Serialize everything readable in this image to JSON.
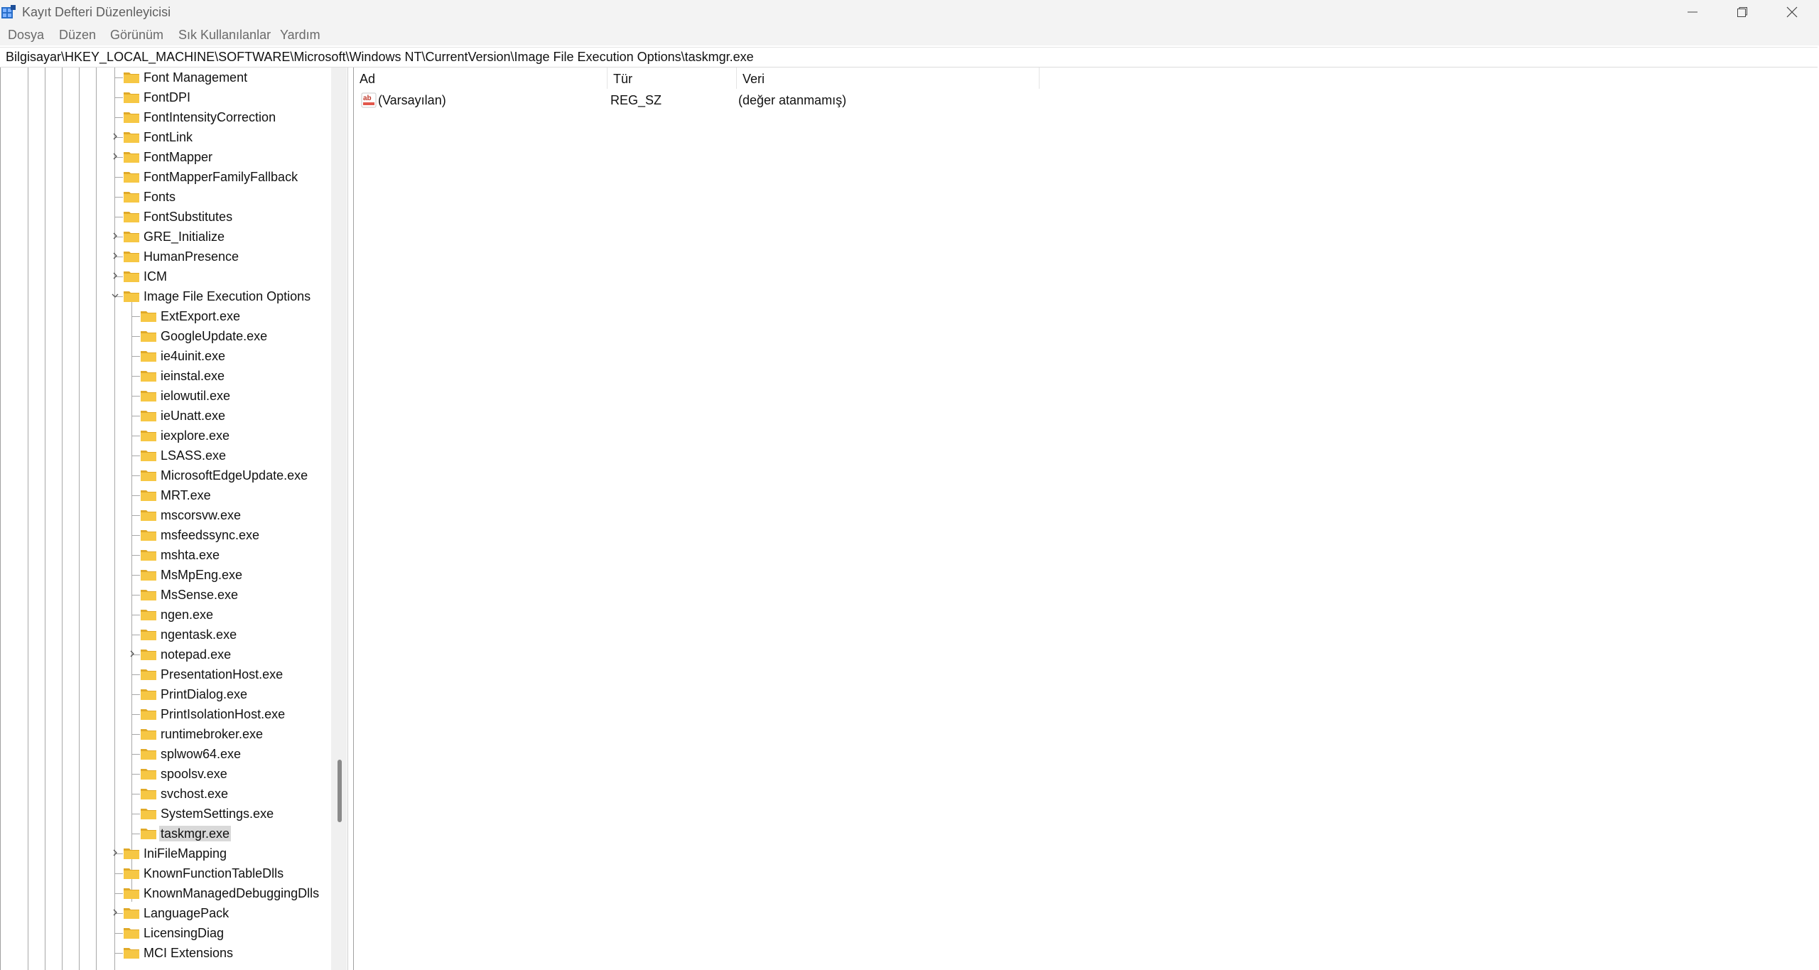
{
  "window": {
    "title": "Kayıt Defteri Düzenleyicisi",
    "controls": [
      "minimize-icon",
      "maximize-icon",
      "close-icon"
    ]
  },
  "menu": {
    "items": [
      "Dosya",
      "Düzen",
      "Görünüm",
      "Sık Kullanılanlar",
      "Yardım"
    ]
  },
  "address": {
    "path": "Bilgisayar\\HKEY_LOCAL_MACHINE\\SOFTWARE\\Microsoft\\Windows NT\\CurrentVersion\\Image File Execution Options\\taskmgr.exe"
  },
  "tree": {
    "items": [
      {
        "label": "Font Management",
        "level": 1,
        "expandable": false
      },
      {
        "label": "FontDPI",
        "level": 1,
        "expandable": false
      },
      {
        "label": "FontIntensityCorrection",
        "level": 1,
        "expandable": false
      },
      {
        "label": "FontLink",
        "level": 1,
        "expandable": true
      },
      {
        "label": "FontMapper",
        "level": 1,
        "expandable": true
      },
      {
        "label": "FontMapperFamilyFallback",
        "level": 1,
        "expandable": false
      },
      {
        "label": "Fonts",
        "level": 1,
        "expandable": false
      },
      {
        "label": "FontSubstitutes",
        "level": 1,
        "expandable": false
      },
      {
        "label": "GRE_Initialize",
        "level": 1,
        "expandable": true
      },
      {
        "label": "HumanPresence",
        "level": 1,
        "expandable": true
      },
      {
        "label": "ICM",
        "level": 1,
        "expandable": true
      },
      {
        "label": "Image File Execution Options",
        "level": 1,
        "expandable": true,
        "expanded": true
      },
      {
        "label": "ExtExport.exe",
        "level": 2,
        "expandable": false
      },
      {
        "label": "GoogleUpdate.exe",
        "level": 2,
        "expandable": false
      },
      {
        "label": "ie4uinit.exe",
        "level": 2,
        "expandable": false
      },
      {
        "label": "ieinstal.exe",
        "level": 2,
        "expandable": false
      },
      {
        "label": "ielowutil.exe",
        "level": 2,
        "expandable": false
      },
      {
        "label": "ieUnatt.exe",
        "level": 2,
        "expandable": false
      },
      {
        "label": "iexplore.exe",
        "level": 2,
        "expandable": false
      },
      {
        "label": "LSASS.exe",
        "level": 2,
        "expandable": false
      },
      {
        "label": "MicrosoftEdgeUpdate.exe",
        "level": 2,
        "expandable": false
      },
      {
        "label": "MRT.exe",
        "level": 2,
        "expandable": false
      },
      {
        "label": "mscorsvw.exe",
        "level": 2,
        "expandable": false
      },
      {
        "label": "msfeedssync.exe",
        "level": 2,
        "expandable": false
      },
      {
        "label": "mshta.exe",
        "level": 2,
        "expandable": false
      },
      {
        "label": "MsMpEng.exe",
        "level": 2,
        "expandable": false
      },
      {
        "label": "MsSense.exe",
        "level": 2,
        "expandable": false
      },
      {
        "label": "ngen.exe",
        "level": 2,
        "expandable": false
      },
      {
        "label": "ngentask.exe",
        "level": 2,
        "expandable": false
      },
      {
        "label": "notepad.exe",
        "level": 2,
        "expandable": true
      },
      {
        "label": "PresentationHost.exe",
        "level": 2,
        "expandable": false
      },
      {
        "label": "PrintDialog.exe",
        "level": 2,
        "expandable": false
      },
      {
        "label": "PrintIsolationHost.exe",
        "level": 2,
        "expandable": false
      },
      {
        "label": "runtimebroker.exe",
        "level": 2,
        "expandable": false
      },
      {
        "label": "splwow64.exe",
        "level": 2,
        "expandable": false
      },
      {
        "label": "spoolsv.exe",
        "level": 2,
        "expandable": false
      },
      {
        "label": "svchost.exe",
        "level": 2,
        "expandable": false
      },
      {
        "label": "SystemSettings.exe",
        "level": 2,
        "expandable": false
      },
      {
        "label": "taskmgr.exe",
        "level": 2,
        "expandable": false,
        "selected": true
      },
      {
        "label": "IniFileMapping",
        "level": 1,
        "expandable": true
      },
      {
        "label": "KnownFunctionTableDlls",
        "level": 1,
        "expandable": false
      },
      {
        "label": "KnownManagedDebuggingDlls",
        "level": 1,
        "expandable": false
      },
      {
        "label": "LanguagePack",
        "level": 1,
        "expandable": true
      },
      {
        "label": "LicensingDiag",
        "level": 1,
        "expandable": false
      },
      {
        "label": "MCI Extensions",
        "level": 1,
        "expandable": false
      }
    ]
  },
  "values": {
    "columns": [
      "Ad",
      "Tür",
      "Veri"
    ],
    "rows": [
      {
        "name": "(Varsayılan)",
        "type": "REG_SZ",
        "data": "(değer atanmamış)",
        "icon": "string-value-icon"
      }
    ]
  },
  "colors": {
    "folder": "#f6c744",
    "selection": "#d9d9d9",
    "chrome": "#f3f3f3",
    "scroll_thumb": "#8a8a8a"
  }
}
